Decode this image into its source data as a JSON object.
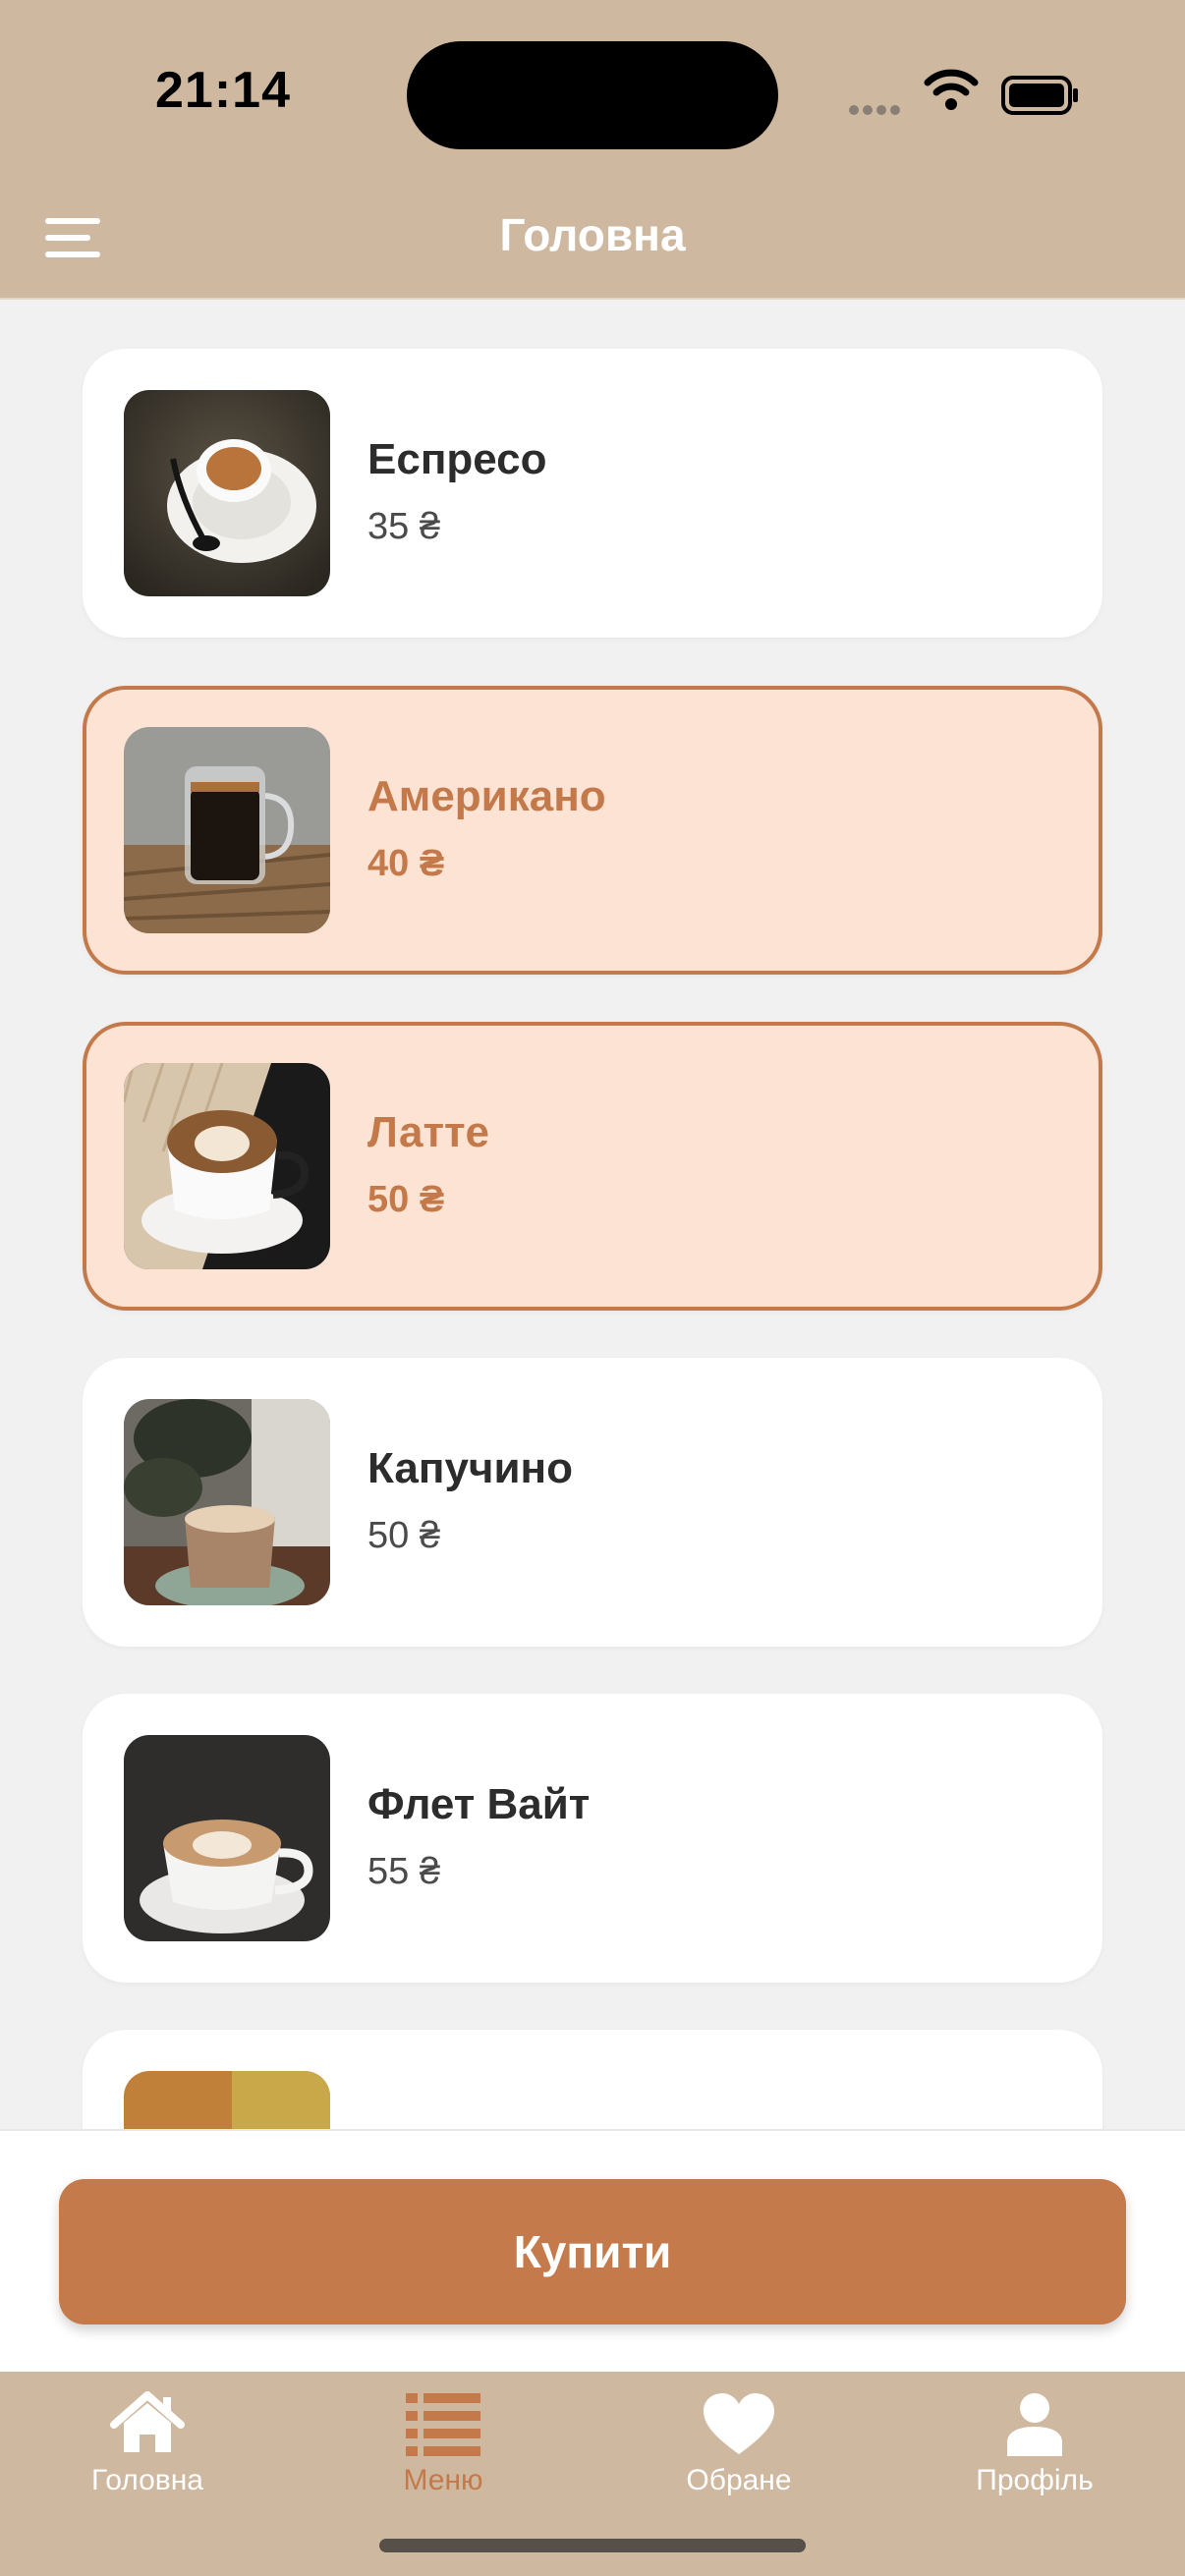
{
  "status_bar": {
    "time": "21:14"
  },
  "header": {
    "title": "Головна",
    "menu_icon": "hamburger-menu-icon"
  },
  "products": [
    {
      "name": "Еспресо",
      "price": "35 ₴",
      "selected": false
    },
    {
      "name": "Американо",
      "price": "40 ₴",
      "selected": true
    },
    {
      "name": "Латте",
      "price": "50 ₴",
      "selected": true
    },
    {
      "name": "Капучино",
      "price": "50 ₴",
      "selected": false
    },
    {
      "name": "Флет Вайт",
      "price": "55 ₴",
      "selected": false
    },
    {
      "name": "",
      "price": "",
      "selected": false
    }
  ],
  "actions": {
    "buy_label": "Купити"
  },
  "tabbar": {
    "items": [
      {
        "label": "Головна",
        "icon": "home-icon",
        "active": false
      },
      {
        "label": "Меню",
        "icon": "list-icon",
        "active": true
      },
      {
        "label": "Обране",
        "icon": "heart-icon",
        "active": false
      },
      {
        "label": "Профіль",
        "icon": "person-icon",
        "active": false
      }
    ]
  },
  "colors": {
    "header_bg": "#cfb8a0",
    "accent": "#c4794b",
    "selected_card_bg": "#fde3d4",
    "page_bg": "#f1f1f1"
  }
}
